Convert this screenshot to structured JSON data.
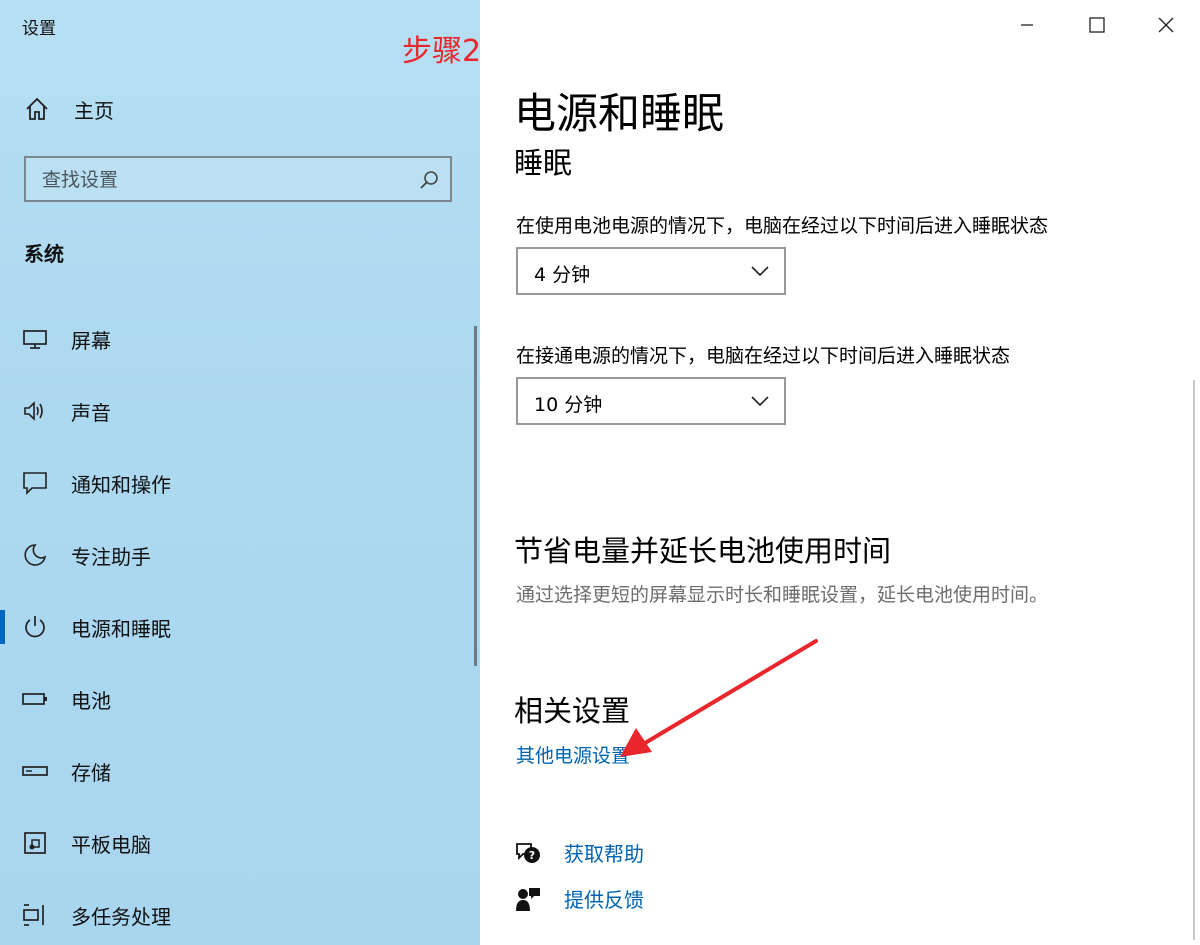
{
  "window": {
    "title": "设置",
    "annotation": "步骤2"
  },
  "sidebar": {
    "home_label": "主页",
    "search_placeholder": "查找设置",
    "section": "系统",
    "items": [
      {
        "label": "屏幕",
        "icon": "monitor-icon"
      },
      {
        "label": "声音",
        "icon": "speaker-icon"
      },
      {
        "label": "通知和操作",
        "icon": "notification-icon"
      },
      {
        "label": "专注助手",
        "icon": "moon-icon"
      },
      {
        "label": "电源和睡眠",
        "icon": "power-icon",
        "selected": true
      },
      {
        "label": "电池",
        "icon": "battery-icon"
      },
      {
        "label": "存储",
        "icon": "storage-icon"
      },
      {
        "label": "平板电脑",
        "icon": "tablet-icon"
      },
      {
        "label": "多任务处理",
        "icon": "multitask-icon"
      }
    ]
  },
  "main": {
    "title": "电源和睡眠",
    "sleep_heading": "睡眠",
    "battery_label": "在使用电池电源的情况下，电脑在经过以下时间后进入睡眠状态",
    "battery_value": "4 分钟",
    "plugged_label": "在接通电源的情况下，电脑在经过以下时间后进入睡眠状态",
    "plugged_value": "10 分钟",
    "save_heading": "节省电量并延长电池使用时间",
    "save_desc": "通过选择更短的屏幕显示时长和睡眠设置，延长电池使用时间。",
    "related_heading": "相关设置",
    "related_link": "其他电源设置",
    "help_link": "获取帮助",
    "feedback_link": "提供反馈"
  },
  "colors": {
    "accent": "#0063b1",
    "annotation": "#e8262b",
    "sidebar_bg": "#acd8f0"
  }
}
